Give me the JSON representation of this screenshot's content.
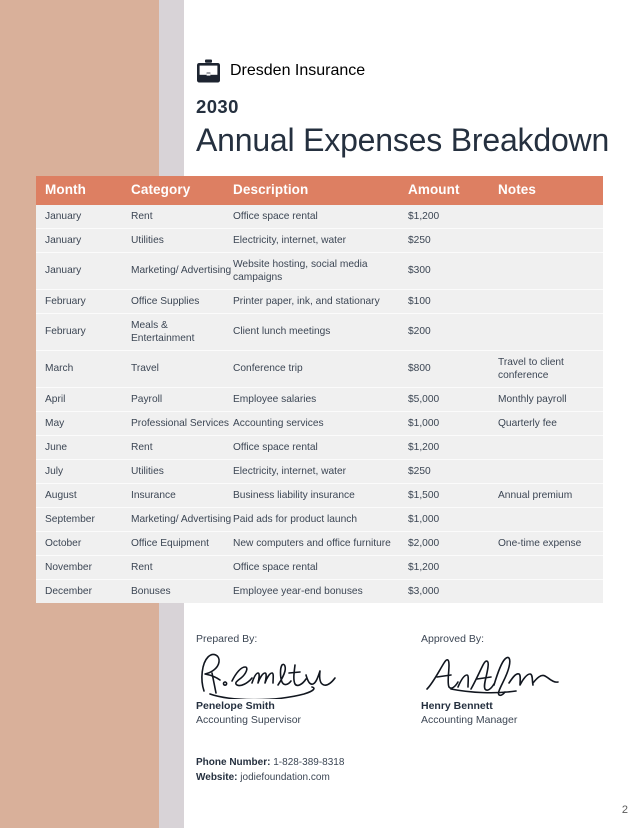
{
  "brand": {
    "name": "Dresden Insurance",
    "icon": "briefcase-icon"
  },
  "header": {
    "year": "2030",
    "title": "Annual Expenses Breakdown"
  },
  "colors": {
    "accent_header": "#dd7f62",
    "bar_tan": "#d9b09a",
    "bar_lavender": "#d8d3d7",
    "row_background": "#f0f0f0",
    "text_dark": "#25303f"
  },
  "table": {
    "columns": [
      "Month",
      "Category",
      "Description",
      "Amount",
      "Notes"
    ],
    "rows": [
      {
        "month": "January",
        "category": "Rent",
        "description": "Office space rental",
        "amount": "$1,200",
        "notes": ""
      },
      {
        "month": "January",
        "category": "Utilities",
        "description": "Electricity, internet, water",
        "amount": "$250",
        "notes": ""
      },
      {
        "month": "January",
        "category": "Marketing/ Advertising",
        "description": "Website hosting, social media campaigns",
        "amount": "$300",
        "notes": ""
      },
      {
        "month": "February",
        "category": "Office Supplies",
        "description": "Printer paper, ink, and stationary",
        "amount": "$100",
        "notes": ""
      },
      {
        "month": "February",
        "category": "Meals & Entertainment",
        "description": "Client lunch meetings",
        "amount": "$200",
        "notes": ""
      },
      {
        "month": "March",
        "category": "Travel",
        "description": "Conference trip",
        "amount": "$800",
        "notes": "Travel to client conference"
      },
      {
        "month": "April",
        "category": "Payroll",
        "description": "Employee salaries",
        "amount": "$5,000",
        "notes": "Monthly payroll"
      },
      {
        "month": "May",
        "category": "Professional Services",
        "description": "Accounting services",
        "amount": "$1,000",
        "notes": "Quarterly fee"
      },
      {
        "month": "June",
        "category": "Rent",
        "description": "Office space rental",
        "amount": "$1,200",
        "notes": ""
      },
      {
        "month": "July",
        "category": "Utilities",
        "description": "Electricity, internet, water",
        "amount": "$250",
        "notes": ""
      },
      {
        "month": "August",
        "category": "Insurance",
        "description": "Business liability insurance",
        "amount": "$1,500",
        "notes": "Annual premium"
      },
      {
        "month": "September",
        "category": "Marketing/ Advertising",
        "description": "Paid ads for product launch",
        "amount": "$1,000",
        "notes": ""
      },
      {
        "month": "October",
        "category": "Office Equipment",
        "description": "New computers and office furniture",
        "amount": "$2,000",
        "notes": "One-time expense"
      },
      {
        "month": "November",
        "category": "Rent",
        "description": "Office space rental",
        "amount": "$1,200",
        "notes": ""
      },
      {
        "month": "December",
        "category": "Bonuses",
        "description": "Employee year-end bonuses",
        "amount": "$3,000",
        "notes": ""
      }
    ]
  },
  "signatures": [
    {
      "label": "Prepared By:",
      "name": "Penelope Smith",
      "role": "Accounting Supervisor",
      "mark": "signature-penelope-smith"
    },
    {
      "label": "Approved By:",
      "name": "Henry Bennett",
      "role": "Accounting Manager",
      "mark": "signature-henry-bennett"
    }
  ],
  "contact": {
    "phone_label": "Phone Number:",
    "phone_value": "1-828-389-8318",
    "website_label": "Website:",
    "website_value": "jodiefoundation.com"
  },
  "page_number": "2"
}
